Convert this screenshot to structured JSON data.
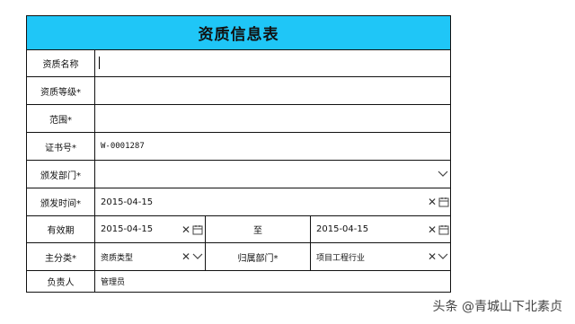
{
  "form": {
    "title": "资质信息表",
    "rows": [
      {
        "label": "资质名称",
        "value": ""
      },
      {
        "label": "资质等级*",
        "value": ""
      },
      {
        "label": "范围*",
        "value": ""
      },
      {
        "label": "证书号*",
        "value": "W-0001287"
      },
      {
        "label": "颁发部门*",
        "value": ""
      },
      {
        "label": "颁发时间*",
        "value": "2015-04-15"
      }
    ],
    "validity": {
      "label": "有效期",
      "start": "2015-04-15",
      "to_label": "至",
      "end": "2015-04-15"
    },
    "category": {
      "label": "主分类*",
      "value": "资质类型",
      "dept_label": "归属部门*",
      "dept_value": "项目工程行业"
    },
    "owner": {
      "label": "负责人",
      "value": "管理员"
    },
    "clear_symbol": "✕"
  },
  "watermark": {
    "text": "头条 @青城山下北素贞"
  }
}
